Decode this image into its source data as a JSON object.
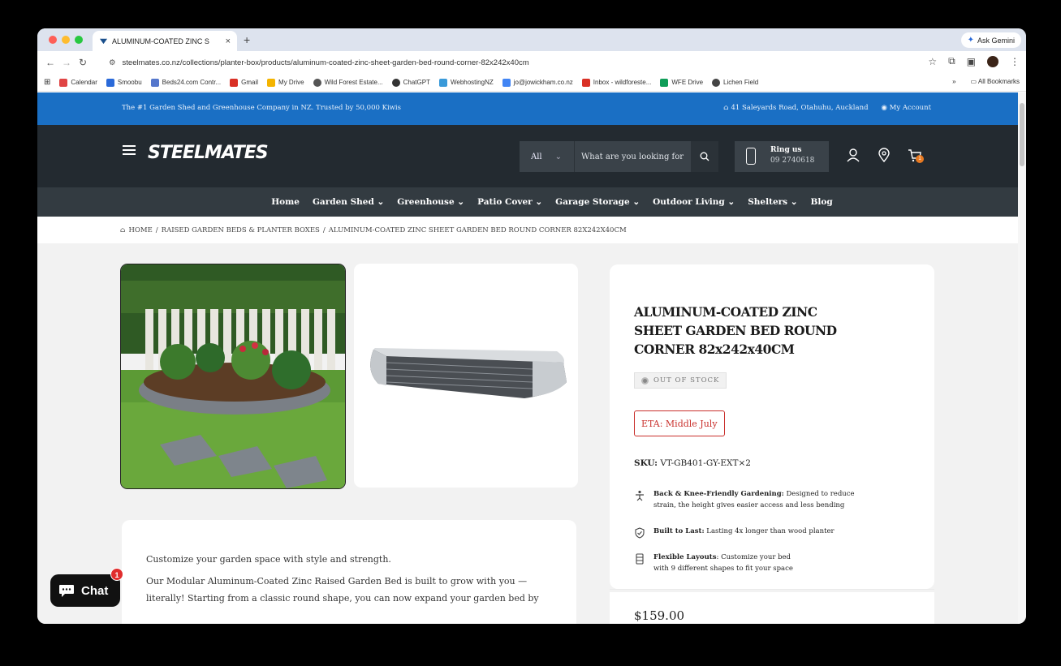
{
  "browser": {
    "tab_title": "ALUMINUM-COATED ZINC S",
    "new_tab": "+",
    "gemini_label": "Ask Gemini",
    "url": "steelmates.co.nz/collections/planter-box/products/aluminum-coated-zinc-sheet-garden-bed-round-corner-82x242x40cm",
    "bookmarks": [
      "Calendar",
      "Smoobu",
      "Beds24.com Contr...",
      "Gmail",
      "My Drive",
      "Wild Forest Estate...",
      "ChatGPT",
      "WebhostingNZ",
      "jo@jowickham.co.nz",
      "Inbox - wildforeste...",
      "WFE Drive",
      "Lichen Field"
    ],
    "bookmarks_overflow": "»",
    "all_bookmarks": "All Bookmarks"
  },
  "announce": {
    "left": "The #1 Garden Shed and Greenhouse Company in NZ. Trusted by 50,000 Kiwis",
    "address": "41 Saleyards Road, Otahuhu, Auckland",
    "account": "My Account"
  },
  "header": {
    "logo": "STEELMATES",
    "search_category": "All",
    "search_placeholder": "What are you looking for",
    "ring_label": "Ring us",
    "ring_phone": "09 2740618",
    "cart_count": "1"
  },
  "menu": [
    "Home",
    "Garden Shed ⌄",
    "Greenhouse ⌄",
    "Patio Cover ⌄",
    "Garage Storage ⌄",
    "Outdoor Living ⌄",
    "Shelters ⌄",
    "Blog"
  ],
  "breadcrumb": {
    "home": "HOME",
    "sep": "/",
    "category": "RAISED GARDEN BEDS & PLANTER BOXES",
    "current": "ALUMINUM-COATED ZINC SHEET GARDEN BED ROUND CORNER 82X242X40CM"
  },
  "product": {
    "title": "ALUMINUM-COATED ZINC SHEET GARDEN BED ROUND CORNER 82x242x40CM",
    "stock": "OUT OF STOCK",
    "eta": "ETA: Middle July",
    "sku_label": "SKU:",
    "sku": "VT-GB401-GY-EXT×2",
    "features": [
      {
        "bold": "Back & Knee-Friendly Gardening:",
        "text": " Designed to reduce",
        "line2": "strain, the height gives easier access and less bending"
      },
      {
        "bold": "Built to Last:",
        "text": " Lasting 4x longer than wood planter",
        "line2": ""
      },
      {
        "bold": "Flexible Layouts",
        "text": ": Customize your bed",
        "line2": "with 9 different shapes to fit your space"
      }
    ],
    "price": "$159.00"
  },
  "description": {
    "p1": "Customize your garden space with style and strength.",
    "p2": "Our Modular Aluminum-Coated Zinc Raised Garden Bed is built to grow with you — literally! Starting from a classic round shape, you can now expand your garden bed by"
  },
  "chat": {
    "label": "Chat",
    "badge": "1"
  }
}
